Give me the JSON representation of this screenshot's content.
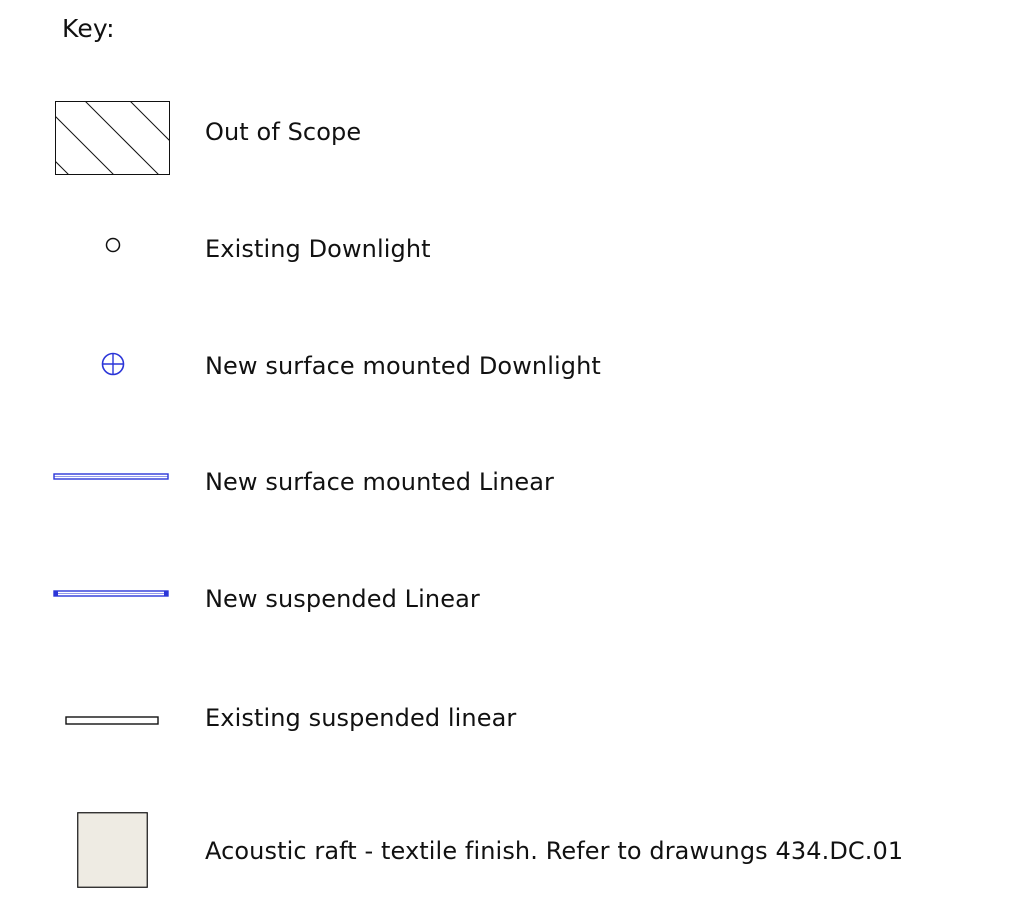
{
  "key": {
    "title": "Key:",
    "items": [
      {
        "symbol": "hatched-rectangle-icon",
        "label": "Out of Scope"
      },
      {
        "symbol": "circle-icon",
        "label": "Existing Downlight"
      },
      {
        "symbol": "crossed-circle-icon",
        "label": "New surface mounted Downlight"
      },
      {
        "symbol": "blue-linear-icon",
        "label": "New surface mounted Linear"
      },
      {
        "symbol": "blue-suspended-linear-icon",
        "label": "New suspended Linear"
      },
      {
        "symbol": "black-linear-icon",
        "label": "Existing suspended linear"
      },
      {
        "symbol": "beige-rectangle-icon",
        "label": "Acoustic raft - textile finish. Refer to drawungs 434.DC.01"
      }
    ]
  },
  "colors": {
    "new_fixture_blue": "#2b35d8",
    "existing_black": "#111111",
    "raft_fill": "#eeebe3"
  }
}
